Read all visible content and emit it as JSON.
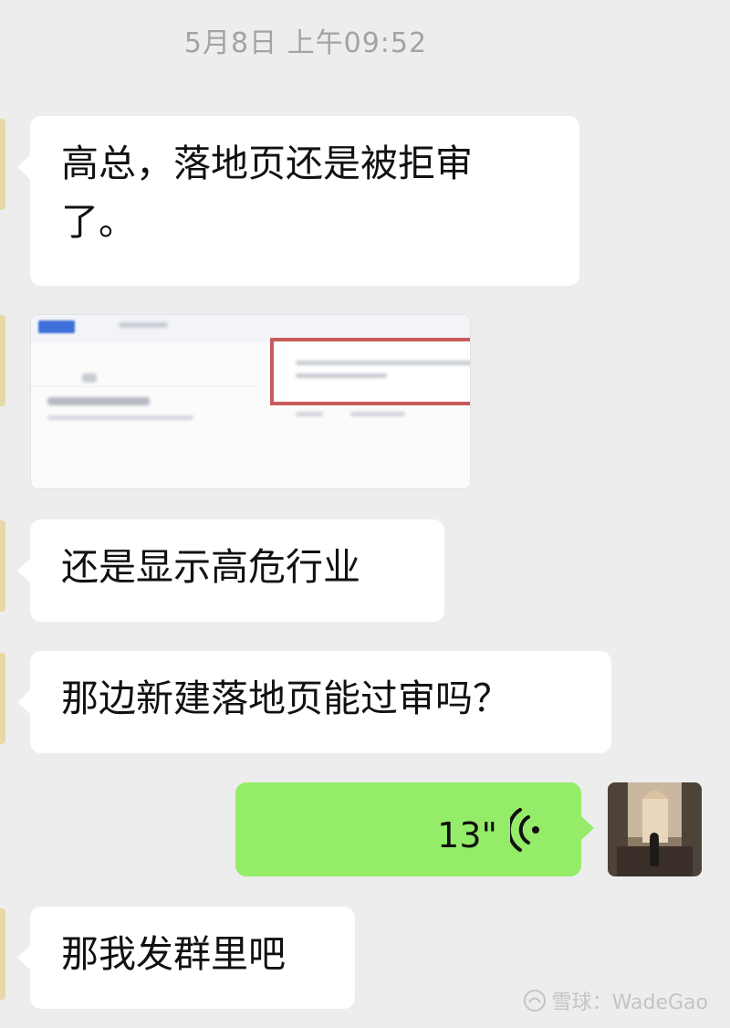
{
  "chat": {
    "timestamp": "5月8日 上午09:52",
    "messages": [
      {
        "text_line1": "高总，落地页还是被拒审",
        "text_line2": "了。"
      },
      {
        "image": "screenshot-image"
      },
      {
        "text": "还是显示高危行业"
      },
      {
        "text": "那边新建落地页能过审吗？"
      },
      {
        "voice_duration": "13\""
      },
      {
        "text": "那我发群里吧"
      }
    ]
  },
  "watermark": {
    "text": "雪球：WadeGao"
  },
  "colors": {
    "background": "#ededed",
    "self_bubble": "#95ec69",
    "other_bubble": "#ffffff"
  }
}
